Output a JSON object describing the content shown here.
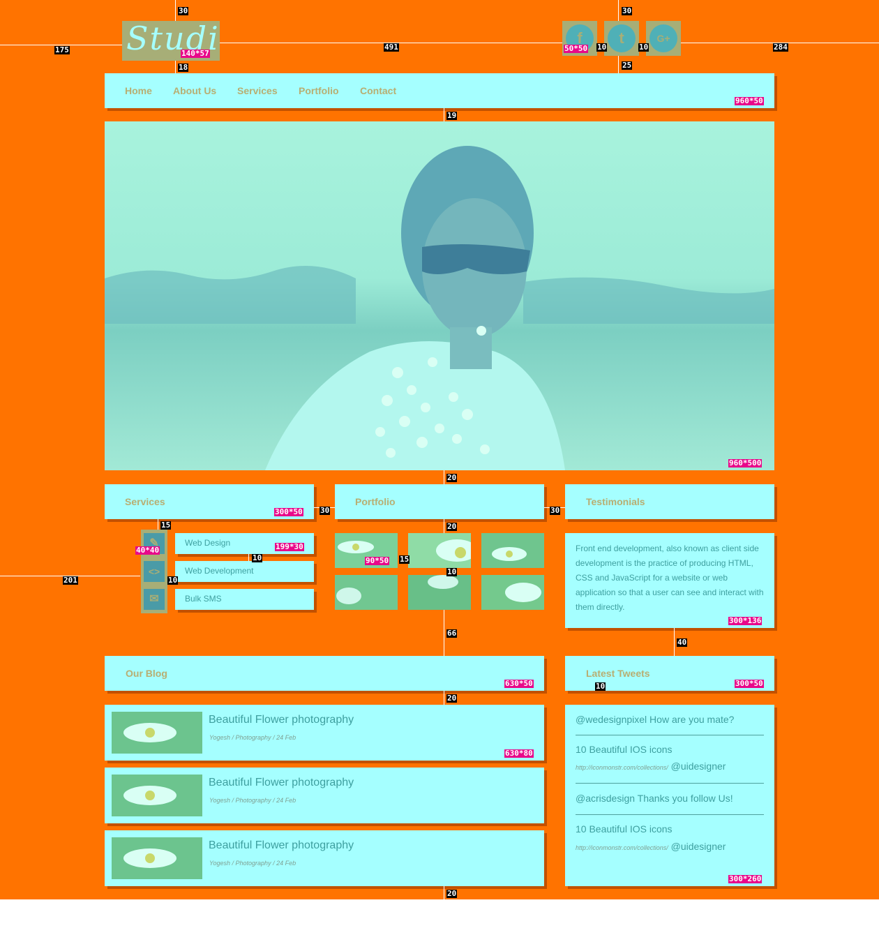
{
  "logo": {
    "text": "Studio"
  },
  "social": [
    {
      "icon": "f"
    },
    {
      "icon": "t"
    },
    {
      "icon": "G+"
    }
  ],
  "nav": [
    "Home",
    "About Us",
    "Services",
    "Portfolio",
    "Contact"
  ],
  "sections": {
    "services": "Services",
    "portfolio": "Portfolio",
    "testimonials": "Testimonials",
    "blog": "Our Blog",
    "tweets": "Latest Tweets"
  },
  "services": [
    {
      "icon": "✎",
      "label": "Web Design"
    },
    {
      "icon": "<>",
      "label": "Web Development"
    },
    {
      "icon": "✉",
      "label": "Bulk SMS"
    }
  ],
  "testimonial": "Front end development, also known as client side development is the practice of producing HTML, CSS and JavaScript for a website or web application so that a user can see and interact with them directly.",
  "posts": [
    {
      "title": "Beautiful Flower photography",
      "meta": "Yogesh / Photography / 24 Feb"
    },
    {
      "title": "Beautiful Flower photography",
      "meta": "Yogesh / Photography / 24 Feb"
    },
    {
      "title": "Beautiful Flower photography",
      "meta": "Yogesh / Photography / 24 Feb"
    }
  ],
  "tweets": [
    {
      "handle": "@wedesignpixel",
      "text": "How are you mate?"
    },
    {
      "text": "10 Beautiful IOS icons",
      "link": "http://iconmonstr.com/collections/",
      "handle": "@uidesigner"
    },
    {
      "handle": "@acrisdesign",
      "text": "Thanks you follow Us!"
    },
    {
      "text": "10 Beautiful IOS icons",
      "link": "http://iconmonstr.com/collections/",
      "handle": "@uidesigner"
    }
  ],
  "measure": {
    "logo_top": "30",
    "logo_left": "175",
    "logo_size": "140*57",
    "logo_bottom": "18",
    "logo_social_gap": "491",
    "social_top": "30",
    "social_size": "50*50",
    "social_gap1": "10",
    "social_gap2": "10",
    "social_right": "284",
    "social_bottom": "25",
    "nav_size": "960*50",
    "nav_hero_gap": "19",
    "hero_size": "960*500",
    "hero_gap": "20",
    "services_size": "300*50",
    "col_gap1": "30",
    "col_gap2": "30",
    "svc_gap": "15",
    "svc_icon_size": "40*40",
    "svc_btn_size": "199*30",
    "svc_btn_gap": "10",
    "svc_left": "201",
    "svc_icon_gap": "10",
    "portfolio_gap": "20",
    "thumb_size": "90*50",
    "thumb_hgap": "15",
    "thumb_vgap": "10",
    "portfolio_blog_gap": "66",
    "testi_size": "300*136",
    "testi_tweets_gap": "40",
    "blog_size": "630*50",
    "tweets_size": "300*50",
    "tweets_gap": "10",
    "blog_gap": "20",
    "post_size": "630*80",
    "tweets_box_size": "300*260",
    "bottom_gap": "20"
  }
}
